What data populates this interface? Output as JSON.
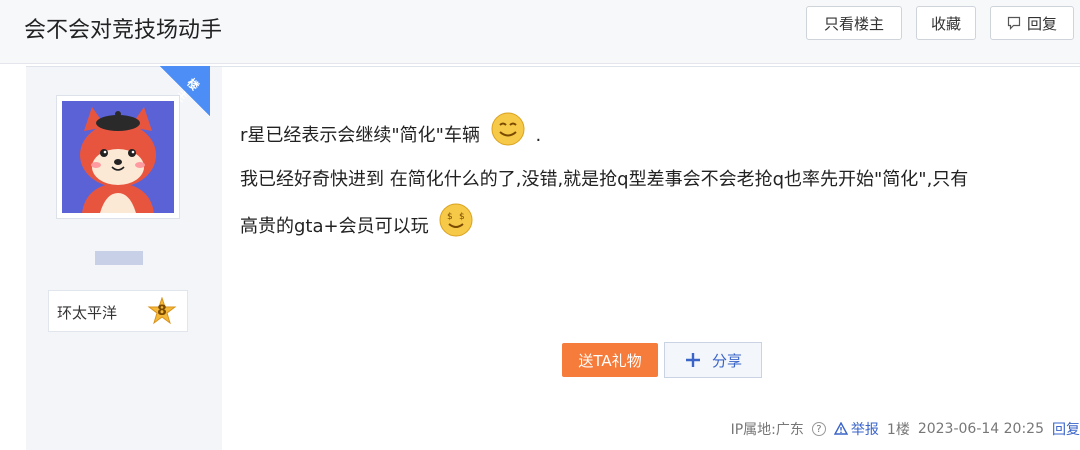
{
  "header": {
    "title": "会不会对竞技场动手",
    "only_op_label": "只看楼主",
    "favorite_label": "收藏",
    "reply_label": "回复"
  },
  "author": {
    "badge": "楼主",
    "name": "环太平洋",
    "level": "8"
  },
  "post": {
    "line1": "r星已经表示会继续\"简化\"车辆",
    "line1_end": ".",
    "line2": "我已经好奇快进到 在简化什么的了,没错,就是抢q型差事会不会老抢q也率先开始\"简化\",只有",
    "line3": "高贵的gta+会员可以玩",
    "gift_label": "送TA礼物",
    "share_label": "分享"
  },
  "footer": {
    "ip": "IP属地:广东",
    "report": "举报",
    "floor": "1楼",
    "datetime": "2023-06-14 20:25",
    "reply": "回复"
  },
  "colors": {
    "accent_blue": "#3a64c8",
    "badge_blue": "#4c8ef5",
    "gift_orange": "#f57c3b"
  }
}
